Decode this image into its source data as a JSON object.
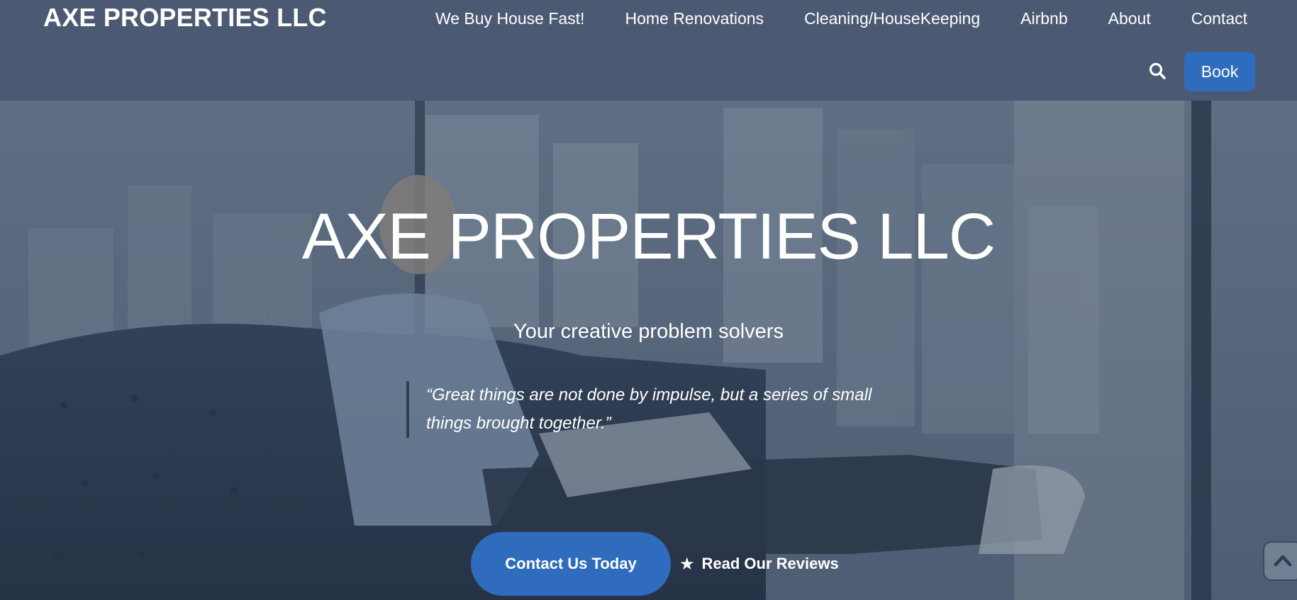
{
  "header": {
    "logo": "AXE PROPERTIES LLC",
    "nav": [
      {
        "label": "We Buy House Fast!"
      },
      {
        "label": "Home Renovations"
      },
      {
        "label": "Cleaning/HouseKeeping"
      },
      {
        "label": "Airbnb"
      },
      {
        "label": "About"
      },
      {
        "label": "Contact"
      }
    ],
    "search_icon": "search-icon",
    "book_label": "Book"
  },
  "hero": {
    "title": "AXE PROPERTIES LLC",
    "subtitle": "Your creative problem solvers",
    "quote": "“Great things are not done by impulse, but a series of small things brought together.”",
    "contact_label": "Contact Us Today",
    "reviews_label": "Read Our Reviews",
    "reviews_icon": "star-icon",
    "scroll_top_icon": "chevron-up-icon"
  },
  "colors": {
    "header_bg": "#4b5a72",
    "accent": "#2f6cbd",
    "text": "#ffffff"
  }
}
